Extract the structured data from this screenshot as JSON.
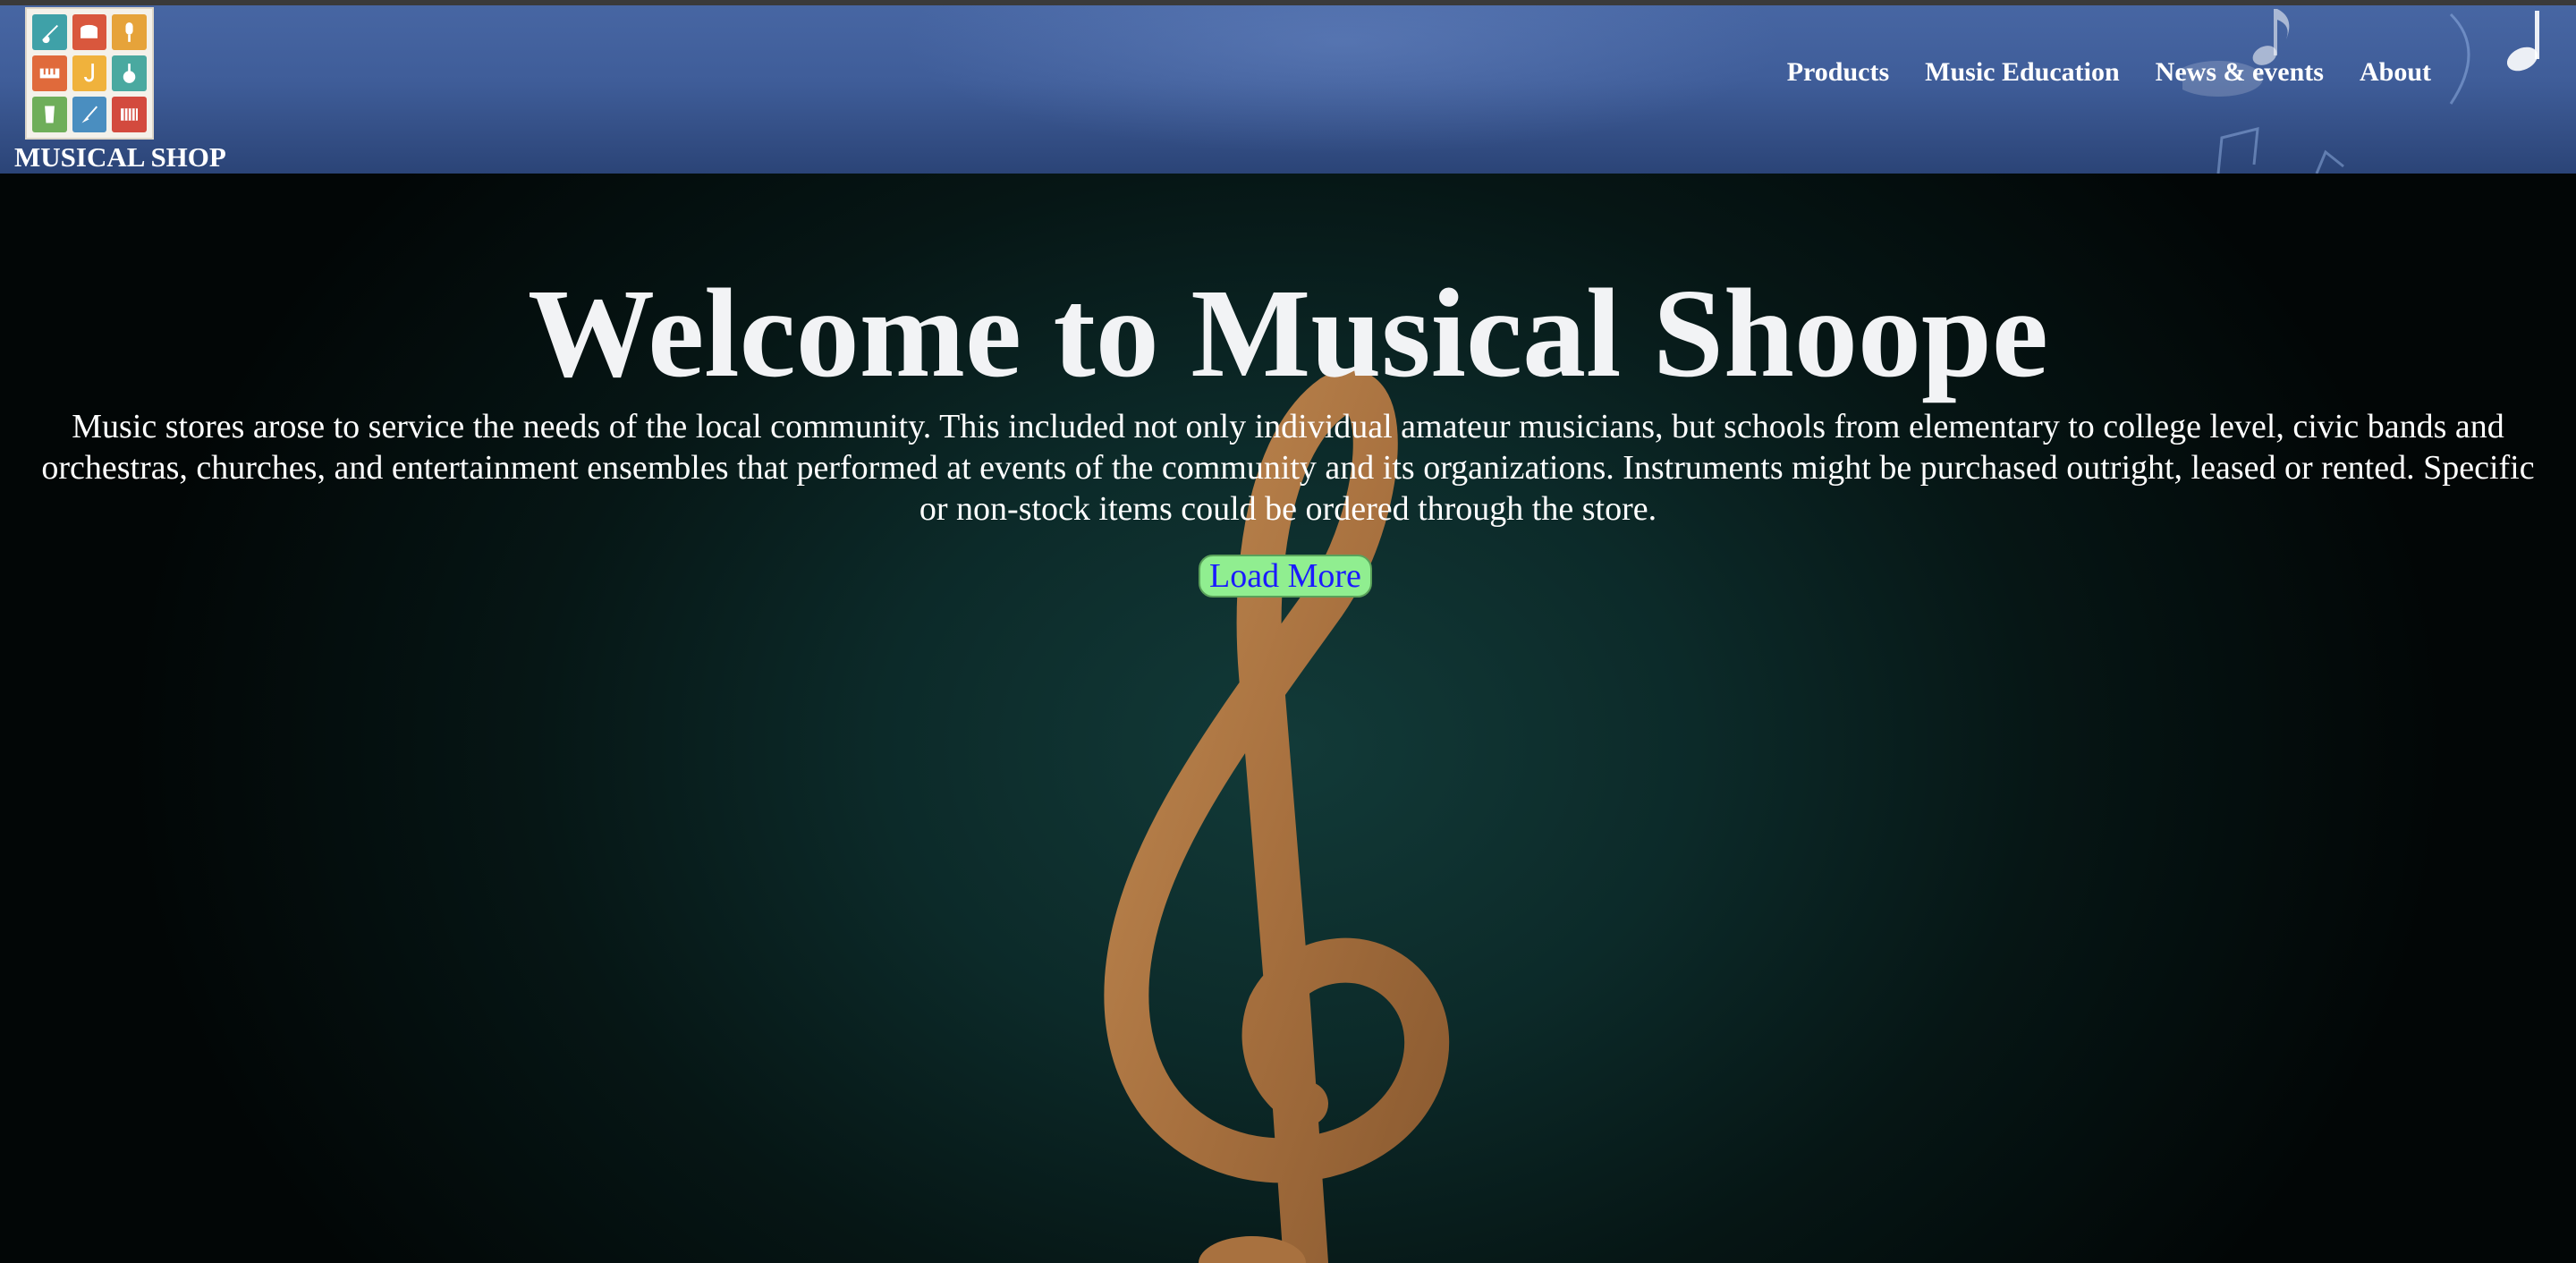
{
  "header": {
    "brand": "MUSICAL SHOP",
    "logo_icons": [
      "guitar-icon",
      "drum-icon",
      "microphone-icon",
      "keyboard-icon",
      "saxophone-icon",
      "banjo-icon",
      "conga-icon",
      "electric-guitar-icon",
      "accordion-icon"
    ],
    "nav": [
      {
        "label": "Products"
      },
      {
        "label": "Music Education"
      },
      {
        "label": "News & events"
      },
      {
        "label": "About"
      }
    ]
  },
  "hero": {
    "title": "Welcome to Musical Shoope",
    "text": "Music stores arose to service the needs of the local community. This included not only individual amateur musicians, but schools from elementary to college level, civic bands and orchestras, churches, and entertainment ensembles that performed at events of the community and its organizations. Instruments might be purchased outright, leased or rented. Specific or non-stock items could be ordered through the store.",
    "button_label": "Load More",
    "background_icon": "treble-clef-icon"
  },
  "colors": {
    "header_blue": "#4766a3",
    "hero_dark": "#0c2a29",
    "button_bg": "#90ee90",
    "button_text": "#1a1aff",
    "clef": "#b07a45"
  }
}
